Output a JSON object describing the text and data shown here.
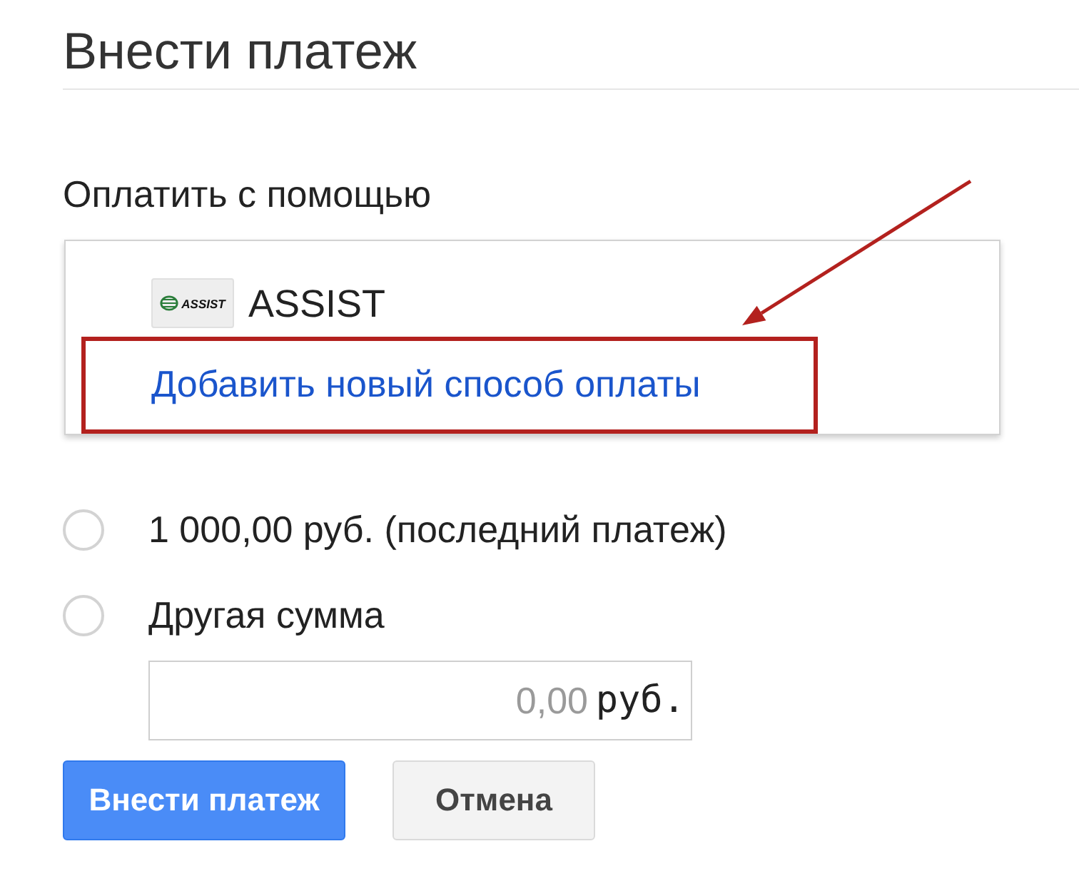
{
  "page": {
    "title": "Внести платеж"
  },
  "payment_method": {
    "label": "Оплатить с помощью",
    "options": [
      {
        "kind": "method",
        "name": "ASSIST",
        "logo_text": "ASSIST",
        "highlighted": false
      },
      {
        "kind": "link",
        "name": "Добавить новый способ оплаты",
        "highlighted": true
      }
    ]
  },
  "amount": {
    "options": [
      {
        "label": "1 000,00 руб. (последний платеж)",
        "selected": false
      },
      {
        "label": "Другая сумма",
        "selected": false
      }
    ],
    "field": {
      "placeholder": "0,00",
      "unit": "руб."
    }
  },
  "buttons": [
    {
      "label": "Внести платеж",
      "kind": "primary"
    },
    {
      "label": "Отмена",
      "kind": "secondary"
    }
  ]
}
